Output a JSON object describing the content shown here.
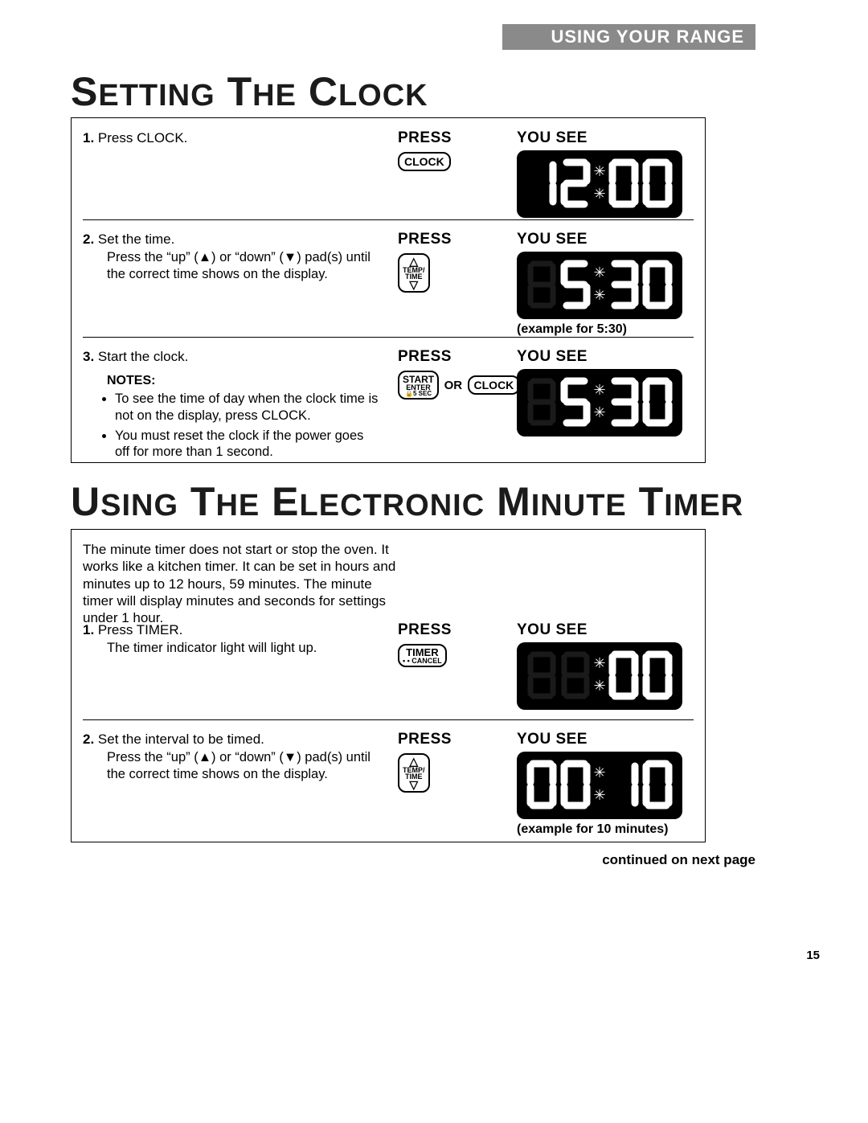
{
  "header": "USING YOUR RANGE",
  "page_number": "15",
  "continued": "continued on next page",
  "labels": {
    "press": "PRESS",
    "you_see": "YOU SEE",
    "or": "OR"
  },
  "buttons": {
    "clock": "CLOCK",
    "temp_time_l1": "TEMP/",
    "temp_time_l2": "TIME",
    "start_l1": "START",
    "start_l2": "ENTER",
    "start_l3": "5 SEC",
    "timer_l1": "TIMER",
    "timer_l2": "• • CANCEL"
  },
  "section1": {
    "title": "SETTING THE CLOCK",
    "step1": {
      "num": "1.",
      "text": "Press CLOCK.",
      "display": "12:00"
    },
    "step2": {
      "num": "2.",
      "text": "Set the time.",
      "sub": "Press the “up” (▲) or “down” (▼) pad(s) until the correct time shows on the display.",
      "display": "5:30",
      "caption": "(example for 5:30)"
    },
    "step3": {
      "num": "3.",
      "text": "Start the clock.",
      "notes_h": "NOTES:",
      "note1": "To see the time of day when the clock time is not on the display, press CLOCK.",
      "note2": "You must reset the clock if the power goes off for more than 1 second.",
      "display": "5:30"
    }
  },
  "section2": {
    "title": "USING THE ELECTRONIC MINUTE TIMER",
    "intro": "The minute timer does not start or stop the oven. It works like a kitchen timer. It can be set in hours and minutes up to 12 hours, 59 minutes. The minute timer will display minutes and seconds for settings under 1 hour.",
    "step1": {
      "num": "1.",
      "text": "Press TIMER.",
      "sub": "The timer indicator light will light up.",
      "display": ":00"
    },
    "step2": {
      "num": "2.",
      "text": "Set the interval to be timed.",
      "sub": "Press the “up” (▲) or “down” (▼) pad(s) until the correct time shows on the display.",
      "display": "00:10",
      "caption": "(example for 10 minutes)"
    }
  }
}
